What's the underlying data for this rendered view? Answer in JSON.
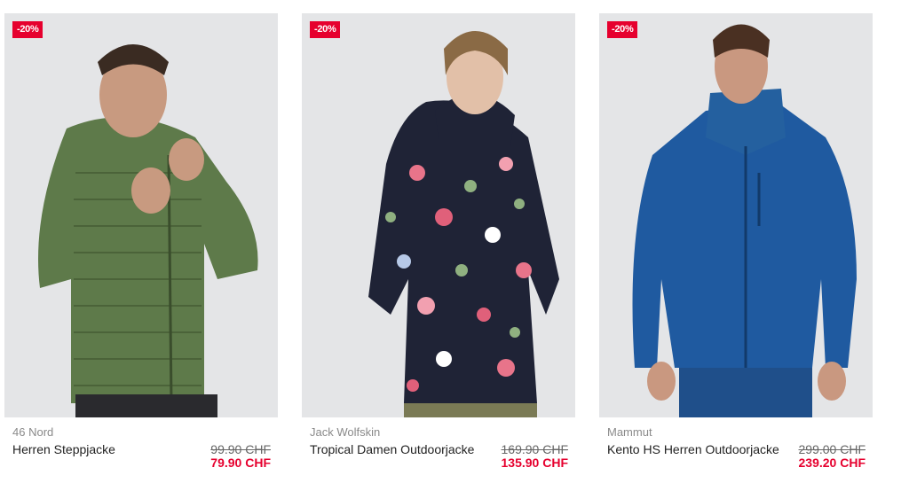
{
  "products": [
    {
      "badge": "-20%",
      "brand": "46 Nord",
      "name": "Herren Steppjacke",
      "old_price": "99.90 CHF",
      "new_price": "79.90 CHF"
    },
    {
      "badge": "-20%",
      "brand": "Jack Wolfskin",
      "name": "Tropical Damen Outdoorjacke",
      "old_price": "169.90 CHF",
      "new_price": "135.90 CHF"
    },
    {
      "badge": "-20%",
      "brand": "Mammut",
      "name": "Kento HS Herren Outdoorjacke",
      "old_price": "299.00 CHF",
      "new_price": "239.20 CHF"
    }
  ],
  "colors": {
    "sale_red": "#e6002e",
    "photo_bg": "#e4e5e7",
    "jacket_green": "#5e7a4a",
    "jacket_navy_floral": "#1f2336",
    "jacket_blue": "#1f5aa0"
  }
}
